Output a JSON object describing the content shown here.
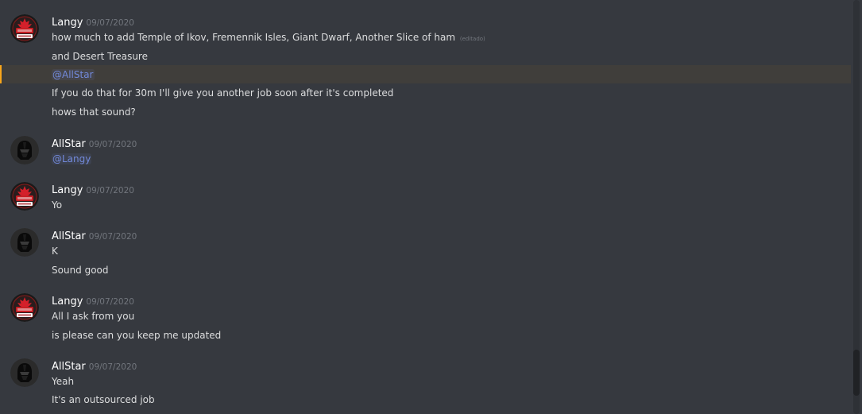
{
  "colors": {
    "background": "#36393f",
    "mention": "#7289da",
    "highlight_bar": "#faa61a",
    "highlight_row": "#403e3b"
  },
  "messages": [
    {
      "author": "Langy",
      "avatar_icon": "maple-leaf-badge-icon",
      "timestamp": "09/07/2020",
      "lines": [
        {
          "text": "how much to add Temple of Ikov, Fremennik Isles, Giant Dwarf, Another Slice of ham",
          "edited": "(editado)"
        },
        {
          "text": "and Desert Treasure"
        },
        {
          "mention": "@AllStar",
          "highlighted": true
        },
        {
          "text": "If you do that for 30m I'll give you another job soon after it's completed"
        },
        {
          "text": "hows that sound?"
        }
      ]
    },
    {
      "author": "AllStar",
      "avatar_icon": "dark-helmet-icon",
      "timestamp": "09/07/2020",
      "lines": [
        {
          "mention": "@Langy"
        }
      ]
    },
    {
      "author": "Langy",
      "avatar_icon": "maple-leaf-badge-icon",
      "timestamp": "09/07/2020",
      "lines": [
        {
          "text": "Yo"
        }
      ]
    },
    {
      "author": "AllStar",
      "avatar_icon": "dark-helmet-icon",
      "timestamp": "09/07/2020",
      "lines": [
        {
          "text": "K"
        },
        {
          "text": "Sound good"
        }
      ]
    },
    {
      "author": "Langy",
      "avatar_icon": "maple-leaf-badge-icon",
      "timestamp": "09/07/2020",
      "lines": [
        {
          "text": "All I ask from you"
        },
        {
          "text": "is please can you keep me updated"
        }
      ]
    },
    {
      "author": "AllStar",
      "avatar_icon": "dark-helmet-icon",
      "timestamp": "09/07/2020",
      "lines": [
        {
          "text": "Yeah"
        },
        {
          "text": "It's an outsourced job"
        }
      ]
    }
  ]
}
